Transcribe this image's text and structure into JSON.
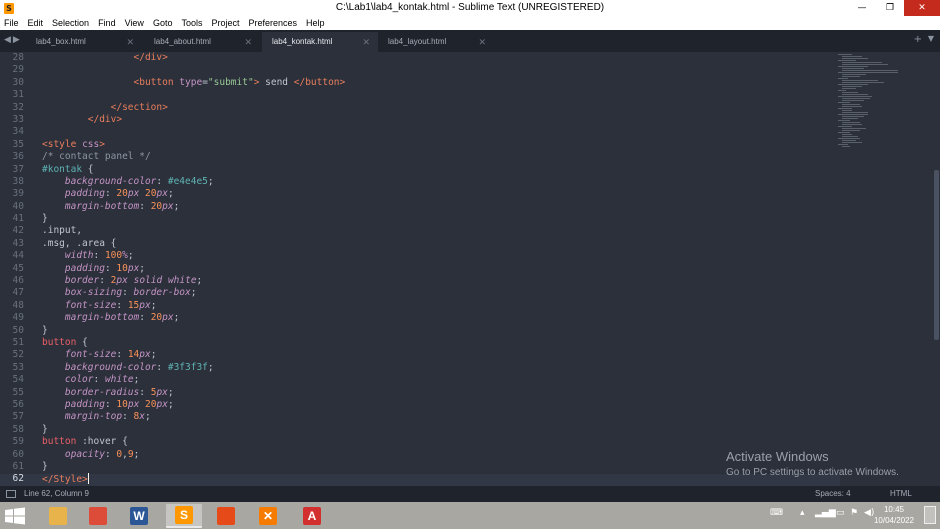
{
  "window": {
    "title": "C:\\Lab1\\lab4_kontak.html - Sublime Text (UNREGISTERED)",
    "app_icon_letter": "S",
    "minimize": "—",
    "maximize": "❐",
    "close": "✕"
  },
  "menu": [
    "File",
    "Edit",
    "Selection",
    "Find",
    "View",
    "Goto",
    "Tools",
    "Project",
    "Preferences",
    "Help"
  ],
  "tabs": [
    {
      "label": "lab4_box.html",
      "active": false
    },
    {
      "label": "lab4_about.html",
      "active": false
    },
    {
      "label": "lab4_kontak.html",
      "active": true
    },
    {
      "label": "lab4_layout.html",
      "active": false
    }
  ],
  "editor": {
    "current_line": 62,
    "lines": [
      {
        "n": "28",
        "html": "                <span class=\"tag\">&lt;/div&gt;</span>"
      },
      {
        "n": "29",
        "html": ""
      },
      {
        "n": "30",
        "html": "                <span class=\"tag\">&lt;button</span> <span class=\"attr\">type</span>=<span class=\"str\">\"submit\"</span><span class=\"tag\">&gt;</span> send <span class=\"tag\">&lt;/button&gt;</span>"
      },
      {
        "n": "31",
        "html": ""
      },
      {
        "n": "32",
        "html": "            <span class=\"tag\">&lt;/section&gt;</span>"
      },
      {
        "n": "33",
        "html": "        <span class=\"tag\">&lt;/div&gt;</span>"
      },
      {
        "n": "34",
        "html": ""
      },
      {
        "n": "35",
        "html": "<span class=\"tag\">&lt;style</span> <span class=\"attr\">css</span><span class=\"tag\">&gt;</span>"
      },
      {
        "n": "36",
        "html": "<span class=\"com\">/* contact panel */</span>"
      },
      {
        "n": "37",
        "html": "<span class=\"hex\">#kontak</span> {"
      },
      {
        "n": "38",
        "html": "    <span class=\"prop\">background-color</span>: <span class=\"hex\">#e4e4e5</span>;"
      },
      {
        "n": "39",
        "html": "    <span class=\"prop\">padding</span>: <span class=\"num\">20</span><span class=\"unit\">px</span> <span class=\"num\">20</span><span class=\"unit\">px</span>;"
      },
      {
        "n": "40",
        "html": "    <span class=\"prop\">margin-bottom</span>: <span class=\"num\">20</span><span class=\"unit\">px</span>;"
      },
      {
        "n": "41",
        "html": "}"
      },
      {
        "n": "42",
        "html": "<span class=\"sel\">.input,</span>"
      },
      {
        "n": "43",
        "html": "<span class=\"sel\">.msg, .area</span> {"
      },
      {
        "n": "44",
        "html": "    <span class=\"prop\">width</span>: <span class=\"num\">100</span><span class=\"unit\">%</span>;"
      },
      {
        "n": "45",
        "html": "    <span class=\"prop\">padding</span>: <span class=\"num\">10</span><span class=\"unit\">px</span>;"
      },
      {
        "n": "46",
        "html": "    <span class=\"prop\">border</span>: <span class=\"num\">2</span><span class=\"unit\">px</span> <span class=\"kw\">solid</span> <span class=\"kw\">white</span>;"
      },
      {
        "n": "47",
        "html": "    <span class=\"prop\">box-sizing</span>: <span class=\"kw\">border-box</span>;"
      },
      {
        "n": "48",
        "html": "    <span class=\"prop\">font-size</span>: <span class=\"num\">15</span><span class=\"unit\">px</span>;"
      },
      {
        "n": "49",
        "html": "    <span class=\"prop\">margin-bottom</span>: <span class=\"num\">20</span><span class=\"unit\">px</span>;"
      },
      {
        "n": "50",
        "html": "}"
      },
      {
        "n": "51",
        "html": "<span class=\"tagn\">button</span> {"
      },
      {
        "n": "52",
        "html": "    <span class=\"prop\">font-size</span>: <span class=\"num\">14</span><span class=\"unit\">px</span>;"
      },
      {
        "n": "53",
        "html": "    <span class=\"prop\">background-color</span>: <span class=\"hex\">#3f3f3f</span>;"
      },
      {
        "n": "54",
        "html": "    <span class=\"prop\">color</span>: <span class=\"kw\">white</span>;"
      },
      {
        "n": "55",
        "html": "    <span class=\"prop\">border-radius</span>: <span class=\"num\">5</span><span class=\"unit\">px</span>;"
      },
      {
        "n": "56",
        "html": "    <span class=\"prop\">padding</span>: <span class=\"num\">10</span><span class=\"unit\">px</span> <span class=\"num\">20</span><span class=\"unit\">px</span>;"
      },
      {
        "n": "57",
        "html": "    <span class=\"prop\">margin-top</span>: <span class=\"num\">8</span><span class=\"unit\">x</span>;"
      },
      {
        "n": "58",
        "html": "}"
      },
      {
        "n": "59",
        "html": "<span class=\"tagn\">button</span> <span class=\"sel\">:hover</span> {"
      },
      {
        "n": "60",
        "html": "    <span class=\"prop\">opacity</span>: <span class=\"num\">0</span>,<span class=\"num\">9</span>;"
      },
      {
        "n": "61",
        "html": "}"
      },
      {
        "n": "62",
        "html": "<span class=\"tag\">&lt;/Style&gt;</span><span class=\"cursor\"></span>"
      }
    ]
  },
  "watermark": {
    "title": "Activate Windows",
    "subtitle": "Go to PC settings to activate Windows."
  },
  "status": {
    "position": "Line 62, Column 9",
    "spaces": "Spaces: 4",
    "syntax": "HTML"
  },
  "taskbar": {
    "apps": [
      {
        "name": "file-explorer-icon",
        "glyph": "",
        "color": "#e8b34a",
        "active": false
      },
      {
        "name": "chrome-icon",
        "glyph": "",
        "color": "#dd4b39",
        "active": false
      },
      {
        "name": "word-icon",
        "glyph": "W",
        "color": "#2b5797",
        "active": false
      },
      {
        "name": "sublime-text-icon",
        "glyph": "S",
        "color": "#ff9800",
        "active": true
      },
      {
        "name": "office-icon",
        "glyph": "",
        "color": "#e64a19",
        "active": false
      },
      {
        "name": "xampp-icon",
        "glyph": "✕",
        "color": "#f57c00",
        "active": false
      },
      {
        "name": "acrobat-icon",
        "glyph": "A",
        "color": "#d32f2f",
        "active": false
      }
    ],
    "time": "10:45",
    "date": "10/04/2022"
  },
  "colors": {
    "background": "#2b303b",
    "chrome": "#1f232b"
  }
}
